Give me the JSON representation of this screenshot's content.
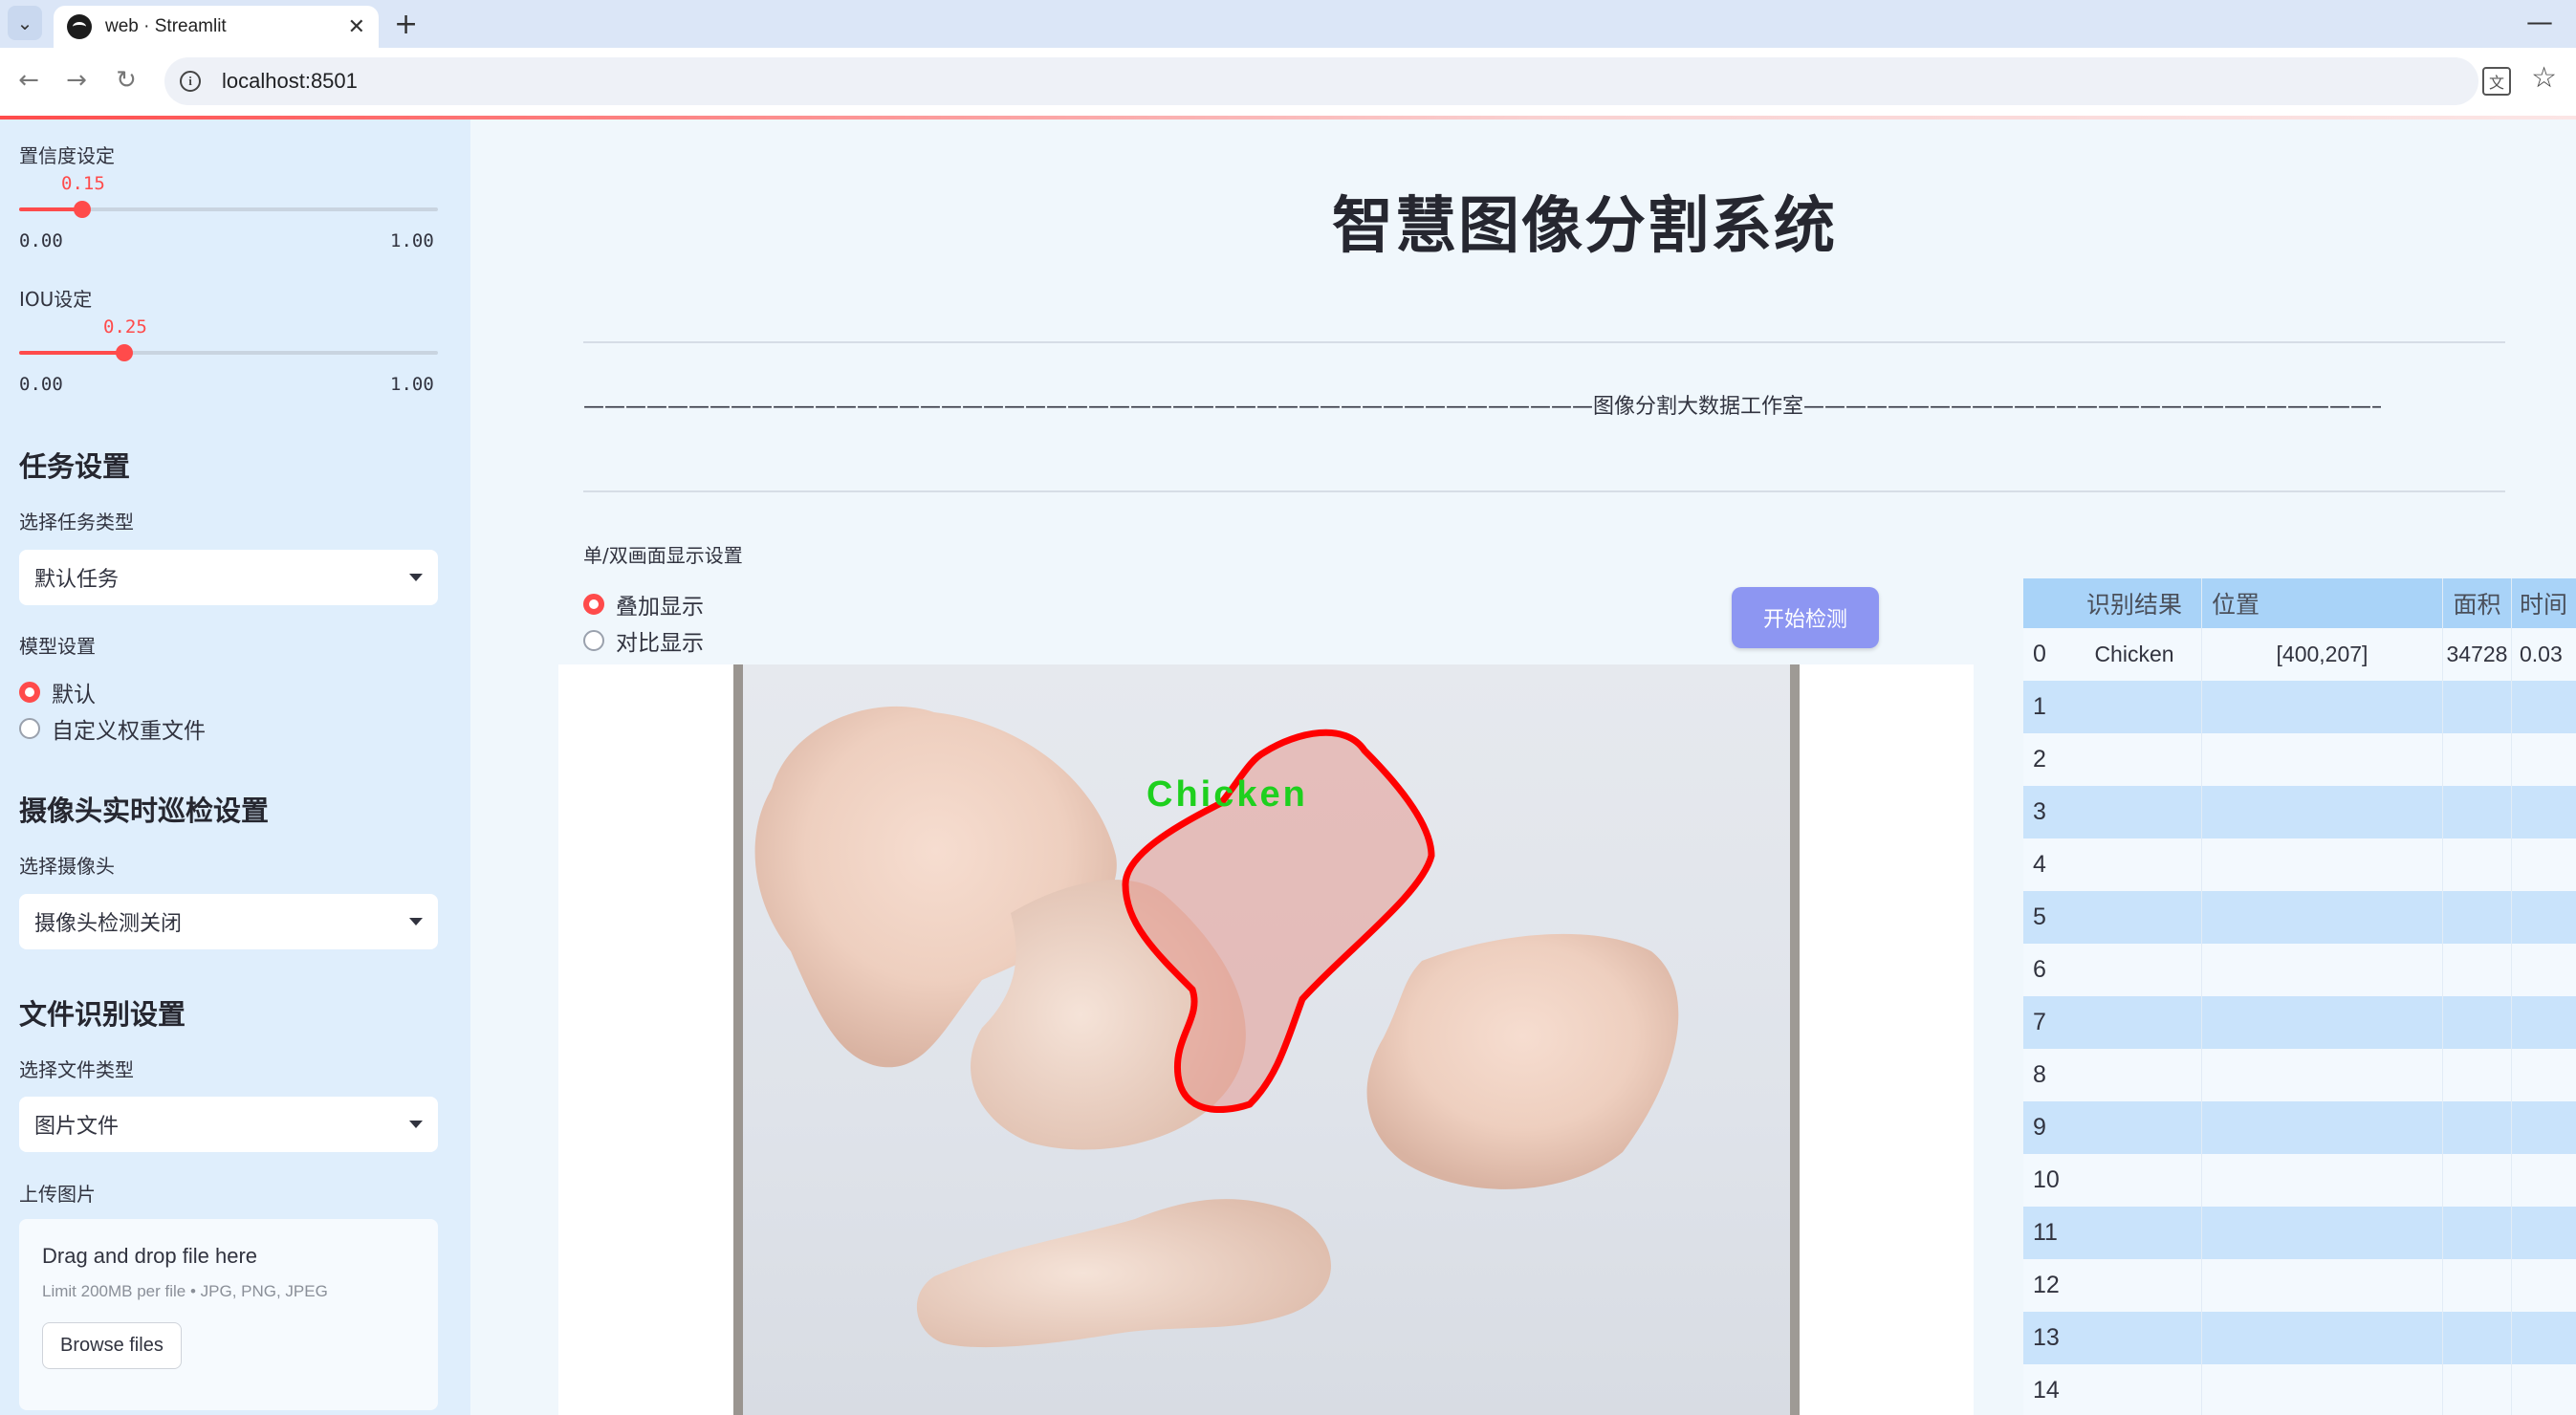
{
  "browser": {
    "tab_title": "web · Streamlit",
    "url": "localhost:8501"
  },
  "sidebar": {
    "confidence": {
      "label": "置信度设定",
      "value": "0.15",
      "min": "0.00",
      "max": "1.00",
      "fraction": 0.15
    },
    "iou": {
      "label": "IOU设定",
      "value": "0.25",
      "min": "0.00",
      "max": "1.00",
      "fraction": 0.25
    },
    "task_heading": "任务设置",
    "task_type_label": "选择任务类型",
    "task_type_value": "默认任务",
    "model_label": "模型设置",
    "model_options": [
      "默认",
      "自定义权重文件"
    ],
    "camera_heading": "摄像头实时巡检设置",
    "camera_label": "选择摄像头",
    "camera_value": "摄像头检测关闭",
    "file_heading": "文件识别设置",
    "file_type_label": "选择文件类型",
    "file_type_value": "图片文件",
    "upload_label": "上传图片",
    "upload": {
      "title": "Drag and drop file here",
      "subtitle": "Limit 200MB per file • JPG, PNG, JPEG",
      "button": "Browse files"
    }
  },
  "main": {
    "title": "智慧图像分割系统",
    "banner": "————————————————————————————————————————————————图像分割大数据工作室————————————————————————————————————————————————————————",
    "display_label": "单/双画面显示设置",
    "display_options": [
      "叠加显示",
      "对比显示"
    ],
    "detect_button": "开始检测",
    "detection_label": "Chicken"
  },
  "table": {
    "headers": [
      "",
      "识别结果",
      "位置",
      "面积",
      "时间"
    ],
    "rows": [
      [
        "0",
        "Chicken",
        "[400,207]",
        "34728",
        "0.03"
      ],
      [
        "1",
        "",
        "",
        "",
        ""
      ],
      [
        "2",
        "",
        "",
        "",
        ""
      ],
      [
        "3",
        "",
        "",
        "",
        ""
      ],
      [
        "4",
        "",
        "",
        "",
        ""
      ],
      [
        "5",
        "",
        "",
        "",
        ""
      ],
      [
        "6",
        "",
        "",
        "",
        ""
      ],
      [
        "7",
        "",
        "",
        "",
        ""
      ],
      [
        "8",
        "",
        "",
        "",
        ""
      ],
      [
        "9",
        "",
        "",
        "",
        ""
      ],
      [
        "10",
        "",
        "",
        "",
        ""
      ],
      [
        "11",
        "",
        "",
        "",
        ""
      ],
      [
        "12",
        "",
        "",
        "",
        ""
      ],
      [
        "13",
        "",
        "",
        "",
        ""
      ],
      [
        "14",
        "",
        "",
        "",
        ""
      ]
    ]
  },
  "colors": {
    "accent": "#ff4b4b",
    "sidebar_bg": "#dfeefc",
    "button": "#8d96f2",
    "mask_outline": "#ff0000",
    "label_text": "#1ed01e"
  }
}
